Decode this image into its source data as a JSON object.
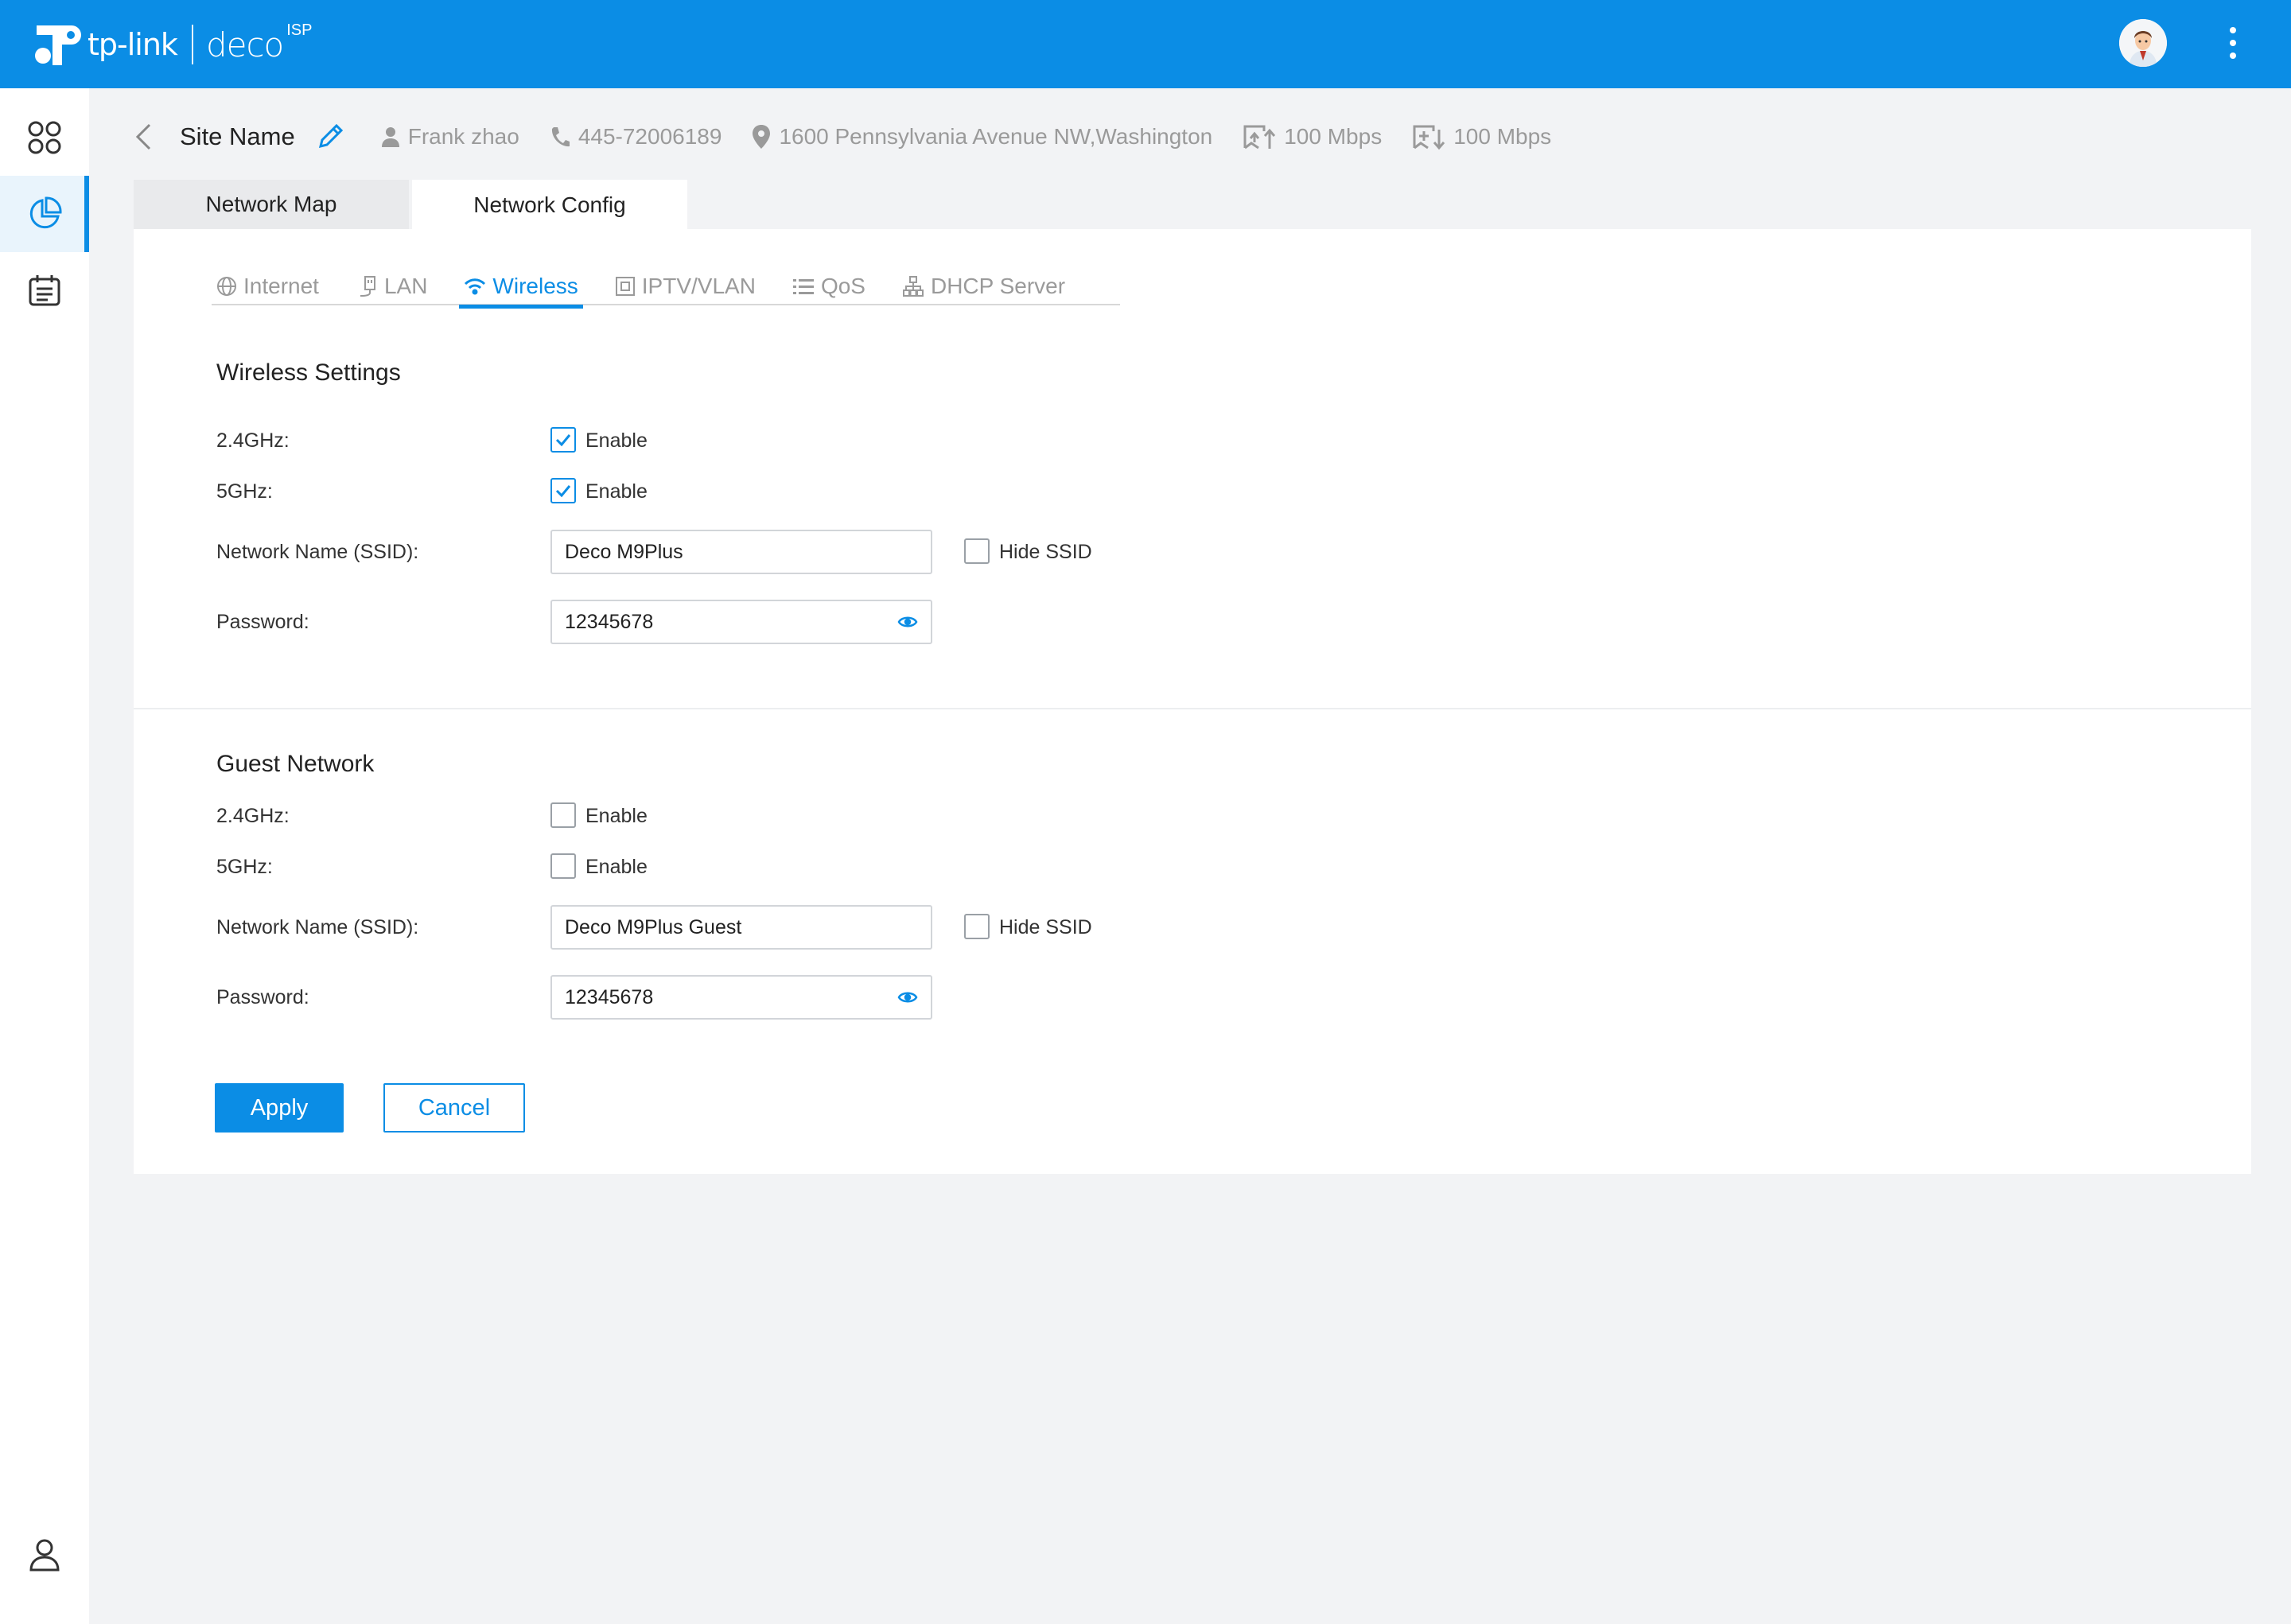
{
  "header": {
    "brand_tplink": "tp-link",
    "brand_deco": "deco",
    "brand_isp": "ISP",
    "accent_color": "#0b8de5"
  },
  "sidebar": {
    "items": [
      {
        "icon": "dashboard-grid-icon",
        "active": false
      },
      {
        "icon": "pie-chart-icon",
        "active": true
      },
      {
        "icon": "calendar-list-icon",
        "active": false
      }
    ],
    "bottom_icon": "user-account-icon"
  },
  "site": {
    "name": "Site Name",
    "owner": "Frank zhao",
    "phone": "445-72006189",
    "address": "1600 Pennsylvania Avenue NW,Washington",
    "upload": "100 Mbps",
    "download": "100 Mbps"
  },
  "tabs": {
    "map_label": "Network Map",
    "config_label": "Network Config",
    "active": "Network Config"
  },
  "subtabs": {
    "internet": "Internet",
    "lan": "LAN",
    "wireless": "Wireless",
    "iptv": "IPTV/VLAN",
    "qos": "QoS",
    "dhcp": "DHCP Server",
    "active": "Wireless"
  },
  "wireless": {
    "title": "Wireless Settings",
    "band24_label": "2.4GHz:",
    "band24_enabled": true,
    "band5_label": "5GHz:",
    "band5_enabled": true,
    "enable_label": "Enable",
    "ssid_label": "Network Name (SSID):",
    "ssid_value": "Deco M9Plus",
    "hide_ssid_label": "Hide SSID",
    "hide_ssid": false,
    "password_label": "Password:",
    "password_value": "12345678"
  },
  "guest": {
    "title": "Guest Network",
    "band24_label": "2.4GHz:",
    "band24_enabled": false,
    "band5_label": "5GHz:",
    "band5_enabled": false,
    "enable_label": "Enable",
    "ssid_label": "Network Name (SSID):",
    "ssid_value": "Deco M9Plus Guest",
    "hide_ssid_label": "Hide SSID",
    "hide_ssid": false,
    "password_label": "Password:",
    "password_value": "12345678"
  },
  "actions": {
    "apply_label": "Apply",
    "cancel_label": "Cancel"
  }
}
